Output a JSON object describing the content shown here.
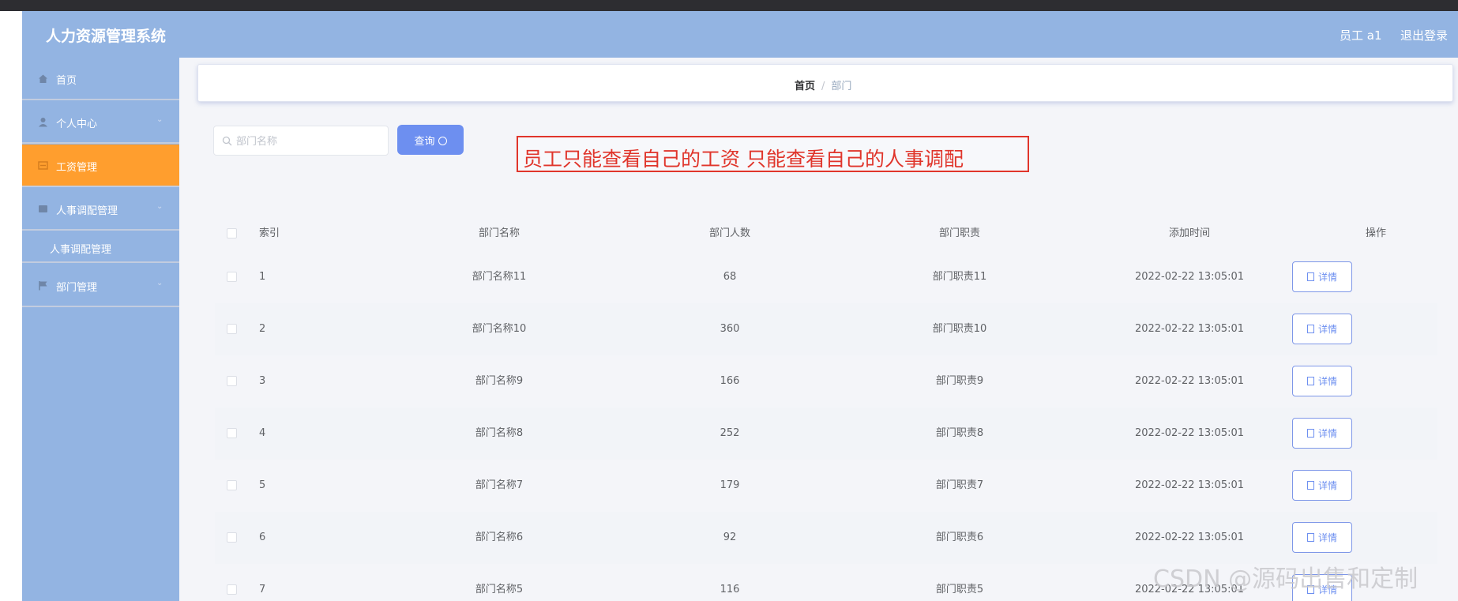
{
  "app": {
    "title": "人力资源管理系统",
    "user": "员工 a1",
    "logout": "退出登录"
  },
  "sidebar": {
    "items": [
      {
        "label": "首页",
        "icon": "home-icon",
        "arrow": ""
      },
      {
        "label": "个人中心",
        "icon": "user-icon",
        "arrow": "⌄"
      },
      {
        "label": "工资管理",
        "icon": "salary-icon",
        "arrow": "",
        "active": true
      },
      {
        "label": "人事调配管理",
        "icon": "folder-icon",
        "arrow": "⌄"
      },
      {
        "label": "部门管理",
        "icon": "flag-icon",
        "arrow": "⌄"
      }
    ],
    "subitems": [
      {
        "label": "人事调配管理"
      }
    ]
  },
  "breadcrumb": {
    "home": "首页",
    "sep": "/",
    "current": "部门"
  },
  "search": {
    "placeholder": "部门名称",
    "button": "查询"
  },
  "annotation": {
    "text": "员工只能查看自己的工资  只能查看自己的人事调配"
  },
  "table": {
    "headers": {
      "index": "索引",
      "name": "部门名称",
      "count": "部门人数",
      "duty": "部门职责",
      "time": "添加时间",
      "op": "操作"
    },
    "detail_label": "详情",
    "rows": [
      {
        "index": "1",
        "name": "部门名称11",
        "count": "68",
        "duty": "部门职责11",
        "time": "2022-02-22 13:05:01"
      },
      {
        "index": "2",
        "name": "部门名称10",
        "count": "360",
        "duty": "部门职责10",
        "time": "2022-02-22 13:05:01"
      },
      {
        "index": "3",
        "name": "部门名称9",
        "count": "166",
        "duty": "部门职责9",
        "time": "2022-02-22 13:05:01"
      },
      {
        "index": "4",
        "name": "部门名称8",
        "count": "252",
        "duty": "部门职责8",
        "time": "2022-02-22 13:05:01"
      },
      {
        "index": "5",
        "name": "部门名称7",
        "count": "179",
        "duty": "部门职责7",
        "time": "2022-02-22 13:05:01"
      },
      {
        "index": "6",
        "name": "部门名称6",
        "count": "92",
        "duty": "部门职责6",
        "time": "2022-02-22 13:05:01"
      },
      {
        "index": "7",
        "name": "部门名称5",
        "count": "116",
        "duty": "部门职责5",
        "time": "2022-02-22 13:05:01"
      }
    ]
  },
  "watermark": "CSDN @源码出售和定制",
  "colors": {
    "topbar": "#93b4e2",
    "sidebar": "#93b4e2",
    "active": "#ff9e2e",
    "primary": "#6d8ff0",
    "annotation": "#e0352b"
  }
}
